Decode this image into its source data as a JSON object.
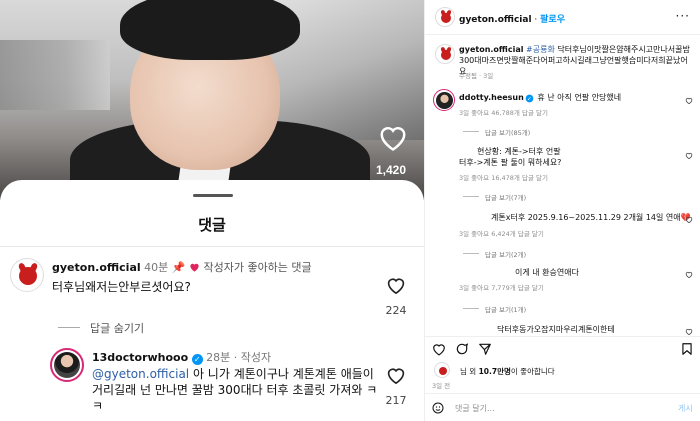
{
  "reel": {
    "like_count": "1,420"
  },
  "sheet": {
    "title": "댓글"
  },
  "comment1": {
    "username": "gyeton.official",
    "time": "40분",
    "pin": "📌",
    "liked_by_creator": "작성자가 좋아하는 댓글",
    "text": "터후님왜저는안부르셧어요?",
    "likes": "224",
    "hide_replies": "답글 숨기기"
  },
  "comment2": {
    "username": "13doctorwhooo",
    "time": "28분",
    "author_badge": "작성자",
    "mention": "@gyeton.official",
    "text": " 아 니가 계톤이구나 계톤계톤 애들이 거리길래 넌 만나면 꿀밤 300대다 터후 초콜릿 가져와 ㅋㅋ",
    "likes": "217"
  },
  "right": {
    "username": "gyeton.official",
    "follow": "팔로우",
    "more": "···",
    "caption_user": "gyeton.official",
    "caption_tag": "#공룡화",
    "caption_text": " 닥터후님이맛짤은얌해주시고만나서꿀밤300대마즈면맛짤해준다어퍼고하시길래그냥언팔햇습미다저희끝났어요",
    "caption_meta": "수정됨 · 3일",
    "comments": [
      {
        "user": "ddotty.heesun",
        "text": " 휴 난 아직 언팔 안당했네",
        "meta": "3일   좋아요 46,788개   답글 달기"
      },
      {
        "text": "답글 보기(85개)"
      },
      {
        "text": "현상황: 계톤->터후 언팔",
        "text2": "터후->계톤 팔 둘이 뭐하세요?",
        "meta": "3일   좋아요 16,478개   답글 달기"
      },
      {
        "text": "답글 보기(7개)"
      },
      {
        "text": "계톤x터후 2025.9.16~2025.11.29 2개월 14일 연애",
        "heart": "💔",
        "meta": "3일   좋아요 6,424개   답글 달기"
      },
      {
        "text": "답글 보기(2개)"
      },
      {
        "text": "이게 내 환승연애다",
        "meta": "3일   좋아요 7,779개   답글 달기"
      },
      {
        "text": "답글 보기(1개)"
      },
      {
        "text": "닥터후동가오잡지마우리계톤이한테"
      }
    ],
    "likes_prefix": "님 외 ",
    "likes_count": "10.7만명",
    "likes_suffix": "이 좋아합니다",
    "days": "3일 전",
    "input_placeholder": "댓글 달기...",
    "post": "게시"
  }
}
